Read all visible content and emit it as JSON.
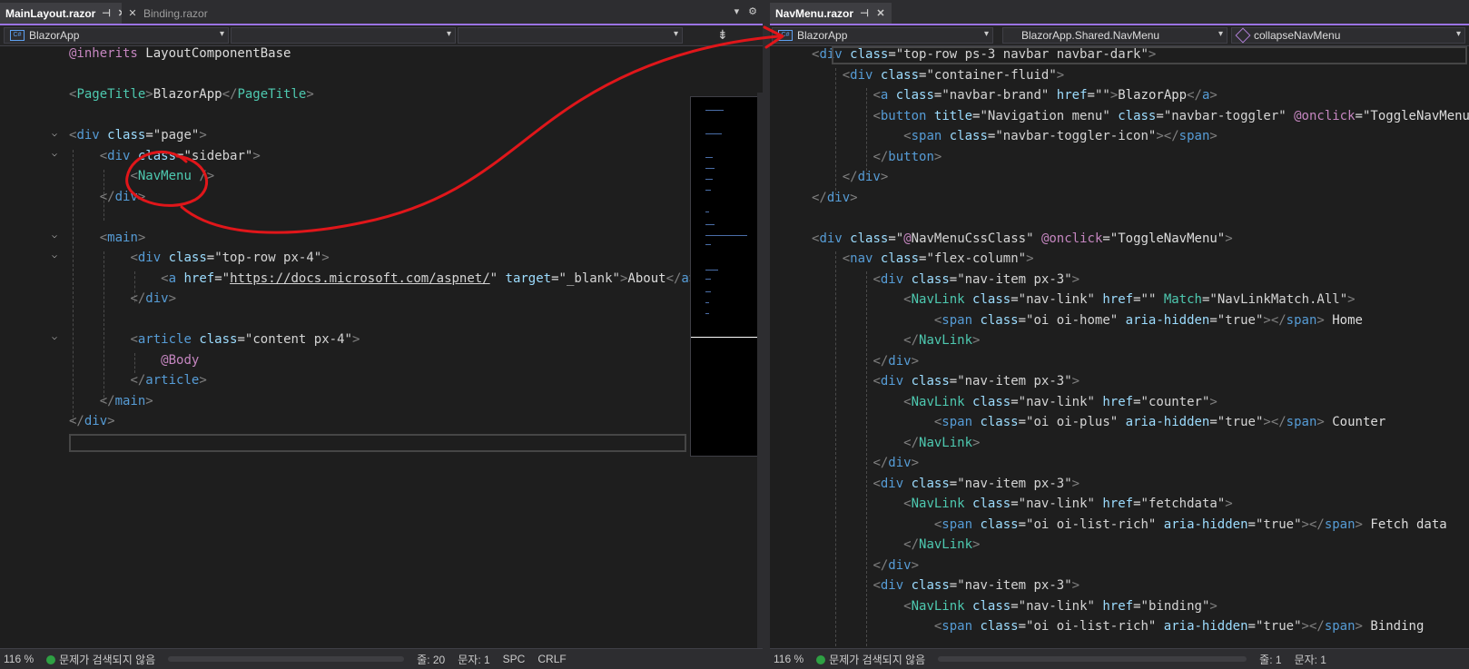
{
  "left": {
    "tabs": [
      {
        "label": "MainLayout.razor",
        "active": true,
        "pin": "⊣",
        "close": "✕"
      },
      {
        "label": "Binding.razor",
        "active": false,
        "close": "✕"
      }
    ],
    "tabbar_icons": [
      "dropdown-icon",
      "gear-icon"
    ],
    "nav": {
      "project": "BlazorApp",
      "type_dd": "",
      "member_dd": ""
    },
    "code": [
      "@inherits LayoutComponentBase",
      "",
      "<PageTitle>BlazorApp</PageTitle>",
      "",
      "<div class=\"page\">",
      "    <div class=\"sidebar\">",
      "        <NavMenu />",
      "    </div>",
      "",
      "    <main>",
      "        <div class=\"top-row px-4\">",
      "            <a href=\"https://docs.microsoft.com/aspnet/\" target=\"_blank\">About</a>",
      "        </div>",
      "",
      "        <article class=\"content px-4\">",
      "            @Body",
      "        </article>",
      "    </main>",
      "</div>"
    ],
    "status": {
      "zoom": "116 %",
      "issues": "문제가 검색되지 않음",
      "line": "줄: 20",
      "col": "문자: 1",
      "spc": "SPC",
      "eol": "CRLF"
    }
  },
  "right": {
    "tabs": [
      {
        "label": "NavMenu.razor",
        "active": true,
        "pin": "⊣",
        "close": "✕"
      }
    ],
    "nav": {
      "project": "BlazorApp",
      "type_dd": "BlazorApp.Shared.NavMenu",
      "member_dd": "collapseNavMenu"
    },
    "code": [
      "<div class=\"top-row ps-3 navbar navbar-dark\">",
      "    <div class=\"container-fluid\">",
      "        <a class=\"navbar-brand\" href=\"\">BlazorApp</a>",
      "        <button title=\"Navigation menu\" class=\"navbar-toggler\" @onclick=\"ToggleNavMenu\">",
      "            <span class=\"navbar-toggler-icon\"></span>",
      "        </button>",
      "    </div>",
      "</div>",
      "",
      "<div class=\"@NavMenuCssClass\" @onclick=\"ToggleNavMenu\">",
      "    <nav class=\"flex-column\">",
      "        <div class=\"nav-item px-3\">",
      "            <NavLink class=\"nav-link\" href=\"\" Match=\"NavLinkMatch.All\">",
      "                <span class=\"oi oi-home\" aria-hidden=\"true\"></span> Home",
      "            </NavLink>",
      "        </div>",
      "        <div class=\"nav-item px-3\">",
      "            <NavLink class=\"nav-link\" href=\"counter\">",
      "                <span class=\"oi oi-plus\" aria-hidden=\"true\"></span> Counter",
      "            </NavLink>",
      "        </div>",
      "        <div class=\"nav-item px-3\">",
      "            <NavLink class=\"nav-link\" href=\"fetchdata\">",
      "                <span class=\"oi oi-list-rich\" aria-hidden=\"true\"></span> Fetch data",
      "            </NavLink>",
      "        </div>",
      "        <div class=\"nav-item px-3\">",
      "            <NavLink class=\"nav-link\" href=\"binding\">",
      "                <span class=\"oi oi-list-rich\" aria-hidden=\"true\"></span> Binding"
    ],
    "status": {
      "zoom": "116 %",
      "issues": "문제가 검색되지 않음",
      "line": "줄: 1",
      "col": "문자: 1"
    }
  },
  "annotation": {
    "color": "#e0161a",
    "target": "NavMenu"
  }
}
